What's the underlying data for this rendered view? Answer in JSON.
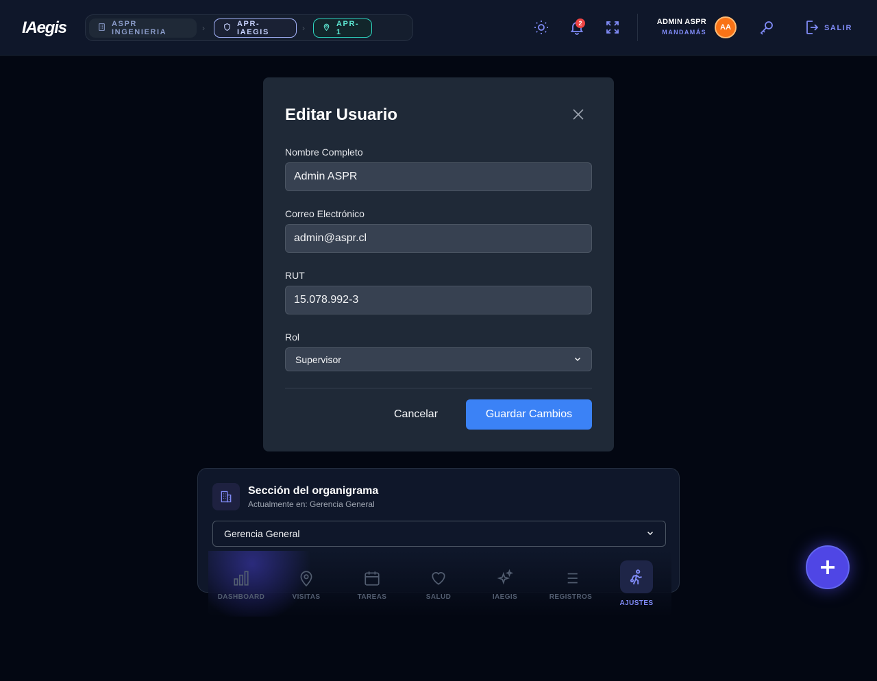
{
  "header": {
    "logo": "IAegis",
    "breadcrumbs": [
      {
        "label": "ASPR INGENIERIA",
        "icon": "building-icon"
      },
      {
        "label": "APR-IAEGIS",
        "icon": "shield-icon"
      },
      {
        "label": "APR-1",
        "icon": "map-pin-icon"
      }
    ],
    "notification_count": "2",
    "user_name": "ADMIN ASPR",
    "user_role": "MANDAMÁS",
    "avatar_initials": "AA",
    "logout_label": "SALIR"
  },
  "modal": {
    "title": "Editar Usuario",
    "fields": {
      "name_label": "Nombre Completo",
      "name_value": "Admin ASPR",
      "email_label": "Correo Electrónico",
      "email_value": "admin@aspr.cl",
      "rut_label": "RUT",
      "rut_value": "15.078.992-3",
      "role_label": "Rol",
      "role_value": "Supervisor"
    },
    "cancel_label": "Cancelar",
    "save_label": "Guardar Cambios"
  },
  "org": {
    "title": "Sección del organigrama",
    "subtitle": "Actualmente en: Gerencia General",
    "selected": "Gerencia General"
  },
  "nav": {
    "items": [
      {
        "label": "DASHBOARD"
      },
      {
        "label": "VISITAS"
      },
      {
        "label": "TAREAS"
      },
      {
        "label": "SALUD"
      },
      {
        "label": "IAEGIS"
      },
      {
        "label": "REGISTROS"
      },
      {
        "label": "AJUSTES"
      }
    ],
    "active": "AJUSTES"
  },
  "colors": {
    "accent": "#818cf8",
    "primary_button": "#3b82f6",
    "badge": "#ef4444",
    "avatar": "#f97316"
  }
}
